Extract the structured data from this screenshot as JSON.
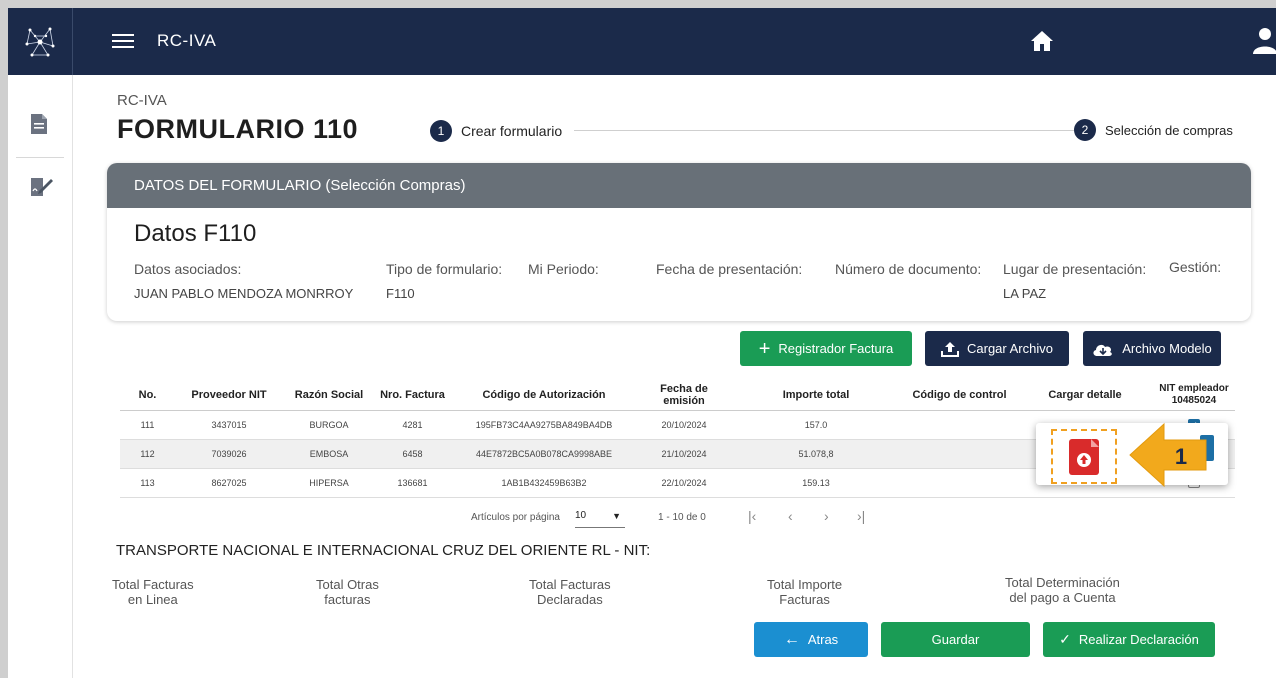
{
  "header": {
    "app_title": "RC-IVA",
    "logo_icon": "network-logo-icon",
    "home_icon": "home-icon",
    "user_icon": "user-icon"
  },
  "breadcrumb": "RC-IVA",
  "page_title": "FORMULARIO 110",
  "stepper": [
    {
      "num": "1",
      "label": "Crear formulario"
    },
    {
      "num": "2",
      "label": "Selección de compras"
    }
  ],
  "card": {
    "header": "DATOS DEL FORMULARIO (Selección Compras)",
    "subtitle": "Datos F110",
    "fields": [
      {
        "label": "Datos asociados:",
        "value": "JUAN PABLO MENDOZA MONRROY"
      },
      {
        "label": "Tipo de formulario:",
        "value": "F110"
      },
      {
        "label": "Mi Periodo:",
        "value": ""
      },
      {
        "label": "Fecha de presentación:",
        "value": ""
      },
      {
        "label": "Número de documento:",
        "value": ""
      },
      {
        "label": "Lugar de presentación:",
        "value": "LA PAZ"
      },
      {
        "label": "Gestión:",
        "value": ""
      }
    ]
  },
  "actions": {
    "registrador": "Registrador Factura",
    "cargar": "Cargar Archivo",
    "modelo": "Archivo Modelo"
  },
  "table": {
    "headers": [
      "No.",
      "Proveedor NIT",
      "Razón Social",
      "Nro. Factura",
      "Código de Autorización",
      "Fecha de emisión",
      "Importe total",
      "Código de control",
      "Cargar detalle",
      "NIT empleador",
      "10485024"
    ],
    "rows": [
      [
        "111",
        "3437015",
        "BURGOA",
        "4281",
        "195FB73C4AA9275BA849BA4DB",
        "20/10/2024",
        "157.0",
        "",
        ""
      ],
      [
        "112",
        "7039026",
        "EMBOSA",
        "6458",
        "44E7872BC5A0B078CA9998ABE",
        "21/10/2024",
        "51.078,8",
        "",
        ""
      ],
      [
        "113",
        "8627025",
        "HIPERSA",
        "136681",
        "1AB1B432459B63B2",
        "22/10/2024",
        "159.13",
        "",
        ""
      ]
    ],
    "checked": [
      true,
      true,
      false
    ]
  },
  "pager": {
    "label": "Artículos por página",
    "size": "10",
    "range": "1 - 10 de 0"
  },
  "transport_title": "TRANSPORTE NACIONAL E INTERNACIONAL CRUZ DEL ORIENTE RL - NIT:",
  "totals": [
    {
      "l1": "Total Facturas",
      "l2": "en Linea"
    },
    {
      "l1": "Total Otras",
      "l2": "facturas"
    },
    {
      "l1": "Total Facturas",
      "l2": "Declaradas"
    },
    {
      "l1": "Total Importe",
      "l2": "Facturas"
    },
    {
      "l1": "Total Determinación",
      "l2": "del pago a Cuenta"
    }
  ],
  "footer_buttons": {
    "back": "Atras",
    "save": "Guardar",
    "submit": "Realizar Declaración"
  },
  "annotation": {
    "marker": "1"
  },
  "colors": {
    "navy": "#1b2a4a",
    "green": "#1a9c55",
    "blue": "#1b8fd1",
    "callout": "#f0a020",
    "pdf_red": "#d92b2b"
  }
}
